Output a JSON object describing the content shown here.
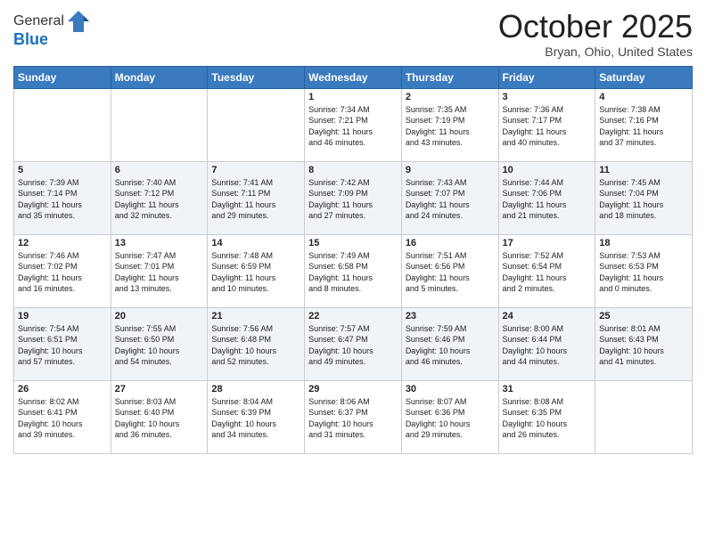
{
  "header": {
    "logo_line1": "General",
    "logo_line2": "Blue",
    "month_title": "October 2025",
    "location": "Bryan, Ohio, United States"
  },
  "days_of_week": [
    "Sunday",
    "Monday",
    "Tuesday",
    "Wednesday",
    "Thursday",
    "Friday",
    "Saturday"
  ],
  "weeks": [
    [
      {
        "day": "",
        "info": ""
      },
      {
        "day": "",
        "info": ""
      },
      {
        "day": "",
        "info": ""
      },
      {
        "day": "1",
        "info": "Sunrise: 7:34 AM\nSunset: 7:21 PM\nDaylight: 11 hours\nand 46 minutes."
      },
      {
        "day": "2",
        "info": "Sunrise: 7:35 AM\nSunset: 7:19 PM\nDaylight: 11 hours\nand 43 minutes."
      },
      {
        "day": "3",
        "info": "Sunrise: 7:36 AM\nSunset: 7:17 PM\nDaylight: 11 hours\nand 40 minutes."
      },
      {
        "day": "4",
        "info": "Sunrise: 7:38 AM\nSunset: 7:16 PM\nDaylight: 11 hours\nand 37 minutes."
      }
    ],
    [
      {
        "day": "5",
        "info": "Sunrise: 7:39 AM\nSunset: 7:14 PM\nDaylight: 11 hours\nand 35 minutes."
      },
      {
        "day": "6",
        "info": "Sunrise: 7:40 AM\nSunset: 7:12 PM\nDaylight: 11 hours\nand 32 minutes."
      },
      {
        "day": "7",
        "info": "Sunrise: 7:41 AM\nSunset: 7:11 PM\nDaylight: 11 hours\nand 29 minutes."
      },
      {
        "day": "8",
        "info": "Sunrise: 7:42 AM\nSunset: 7:09 PM\nDaylight: 11 hours\nand 27 minutes."
      },
      {
        "day": "9",
        "info": "Sunrise: 7:43 AM\nSunset: 7:07 PM\nDaylight: 11 hours\nand 24 minutes."
      },
      {
        "day": "10",
        "info": "Sunrise: 7:44 AM\nSunset: 7:06 PM\nDaylight: 11 hours\nand 21 minutes."
      },
      {
        "day": "11",
        "info": "Sunrise: 7:45 AM\nSunset: 7:04 PM\nDaylight: 11 hours\nand 18 minutes."
      }
    ],
    [
      {
        "day": "12",
        "info": "Sunrise: 7:46 AM\nSunset: 7:02 PM\nDaylight: 11 hours\nand 16 minutes."
      },
      {
        "day": "13",
        "info": "Sunrise: 7:47 AM\nSunset: 7:01 PM\nDaylight: 11 hours\nand 13 minutes."
      },
      {
        "day": "14",
        "info": "Sunrise: 7:48 AM\nSunset: 6:59 PM\nDaylight: 11 hours\nand 10 minutes."
      },
      {
        "day": "15",
        "info": "Sunrise: 7:49 AM\nSunset: 6:58 PM\nDaylight: 11 hours\nand 8 minutes."
      },
      {
        "day": "16",
        "info": "Sunrise: 7:51 AM\nSunset: 6:56 PM\nDaylight: 11 hours\nand 5 minutes."
      },
      {
        "day": "17",
        "info": "Sunrise: 7:52 AM\nSunset: 6:54 PM\nDaylight: 11 hours\nand 2 minutes."
      },
      {
        "day": "18",
        "info": "Sunrise: 7:53 AM\nSunset: 6:53 PM\nDaylight: 11 hours\nand 0 minutes."
      }
    ],
    [
      {
        "day": "19",
        "info": "Sunrise: 7:54 AM\nSunset: 6:51 PM\nDaylight: 10 hours\nand 57 minutes."
      },
      {
        "day": "20",
        "info": "Sunrise: 7:55 AM\nSunset: 6:50 PM\nDaylight: 10 hours\nand 54 minutes."
      },
      {
        "day": "21",
        "info": "Sunrise: 7:56 AM\nSunset: 6:48 PM\nDaylight: 10 hours\nand 52 minutes."
      },
      {
        "day": "22",
        "info": "Sunrise: 7:57 AM\nSunset: 6:47 PM\nDaylight: 10 hours\nand 49 minutes."
      },
      {
        "day": "23",
        "info": "Sunrise: 7:59 AM\nSunset: 6:46 PM\nDaylight: 10 hours\nand 46 minutes."
      },
      {
        "day": "24",
        "info": "Sunrise: 8:00 AM\nSunset: 6:44 PM\nDaylight: 10 hours\nand 44 minutes."
      },
      {
        "day": "25",
        "info": "Sunrise: 8:01 AM\nSunset: 6:43 PM\nDaylight: 10 hours\nand 41 minutes."
      }
    ],
    [
      {
        "day": "26",
        "info": "Sunrise: 8:02 AM\nSunset: 6:41 PM\nDaylight: 10 hours\nand 39 minutes."
      },
      {
        "day": "27",
        "info": "Sunrise: 8:03 AM\nSunset: 6:40 PM\nDaylight: 10 hours\nand 36 minutes."
      },
      {
        "day": "28",
        "info": "Sunrise: 8:04 AM\nSunset: 6:39 PM\nDaylight: 10 hours\nand 34 minutes."
      },
      {
        "day": "29",
        "info": "Sunrise: 8:06 AM\nSunset: 6:37 PM\nDaylight: 10 hours\nand 31 minutes."
      },
      {
        "day": "30",
        "info": "Sunrise: 8:07 AM\nSunset: 6:36 PM\nDaylight: 10 hours\nand 29 minutes."
      },
      {
        "day": "31",
        "info": "Sunrise: 8:08 AM\nSunset: 6:35 PM\nDaylight: 10 hours\nand 26 minutes."
      },
      {
        "day": "",
        "info": ""
      }
    ]
  ]
}
